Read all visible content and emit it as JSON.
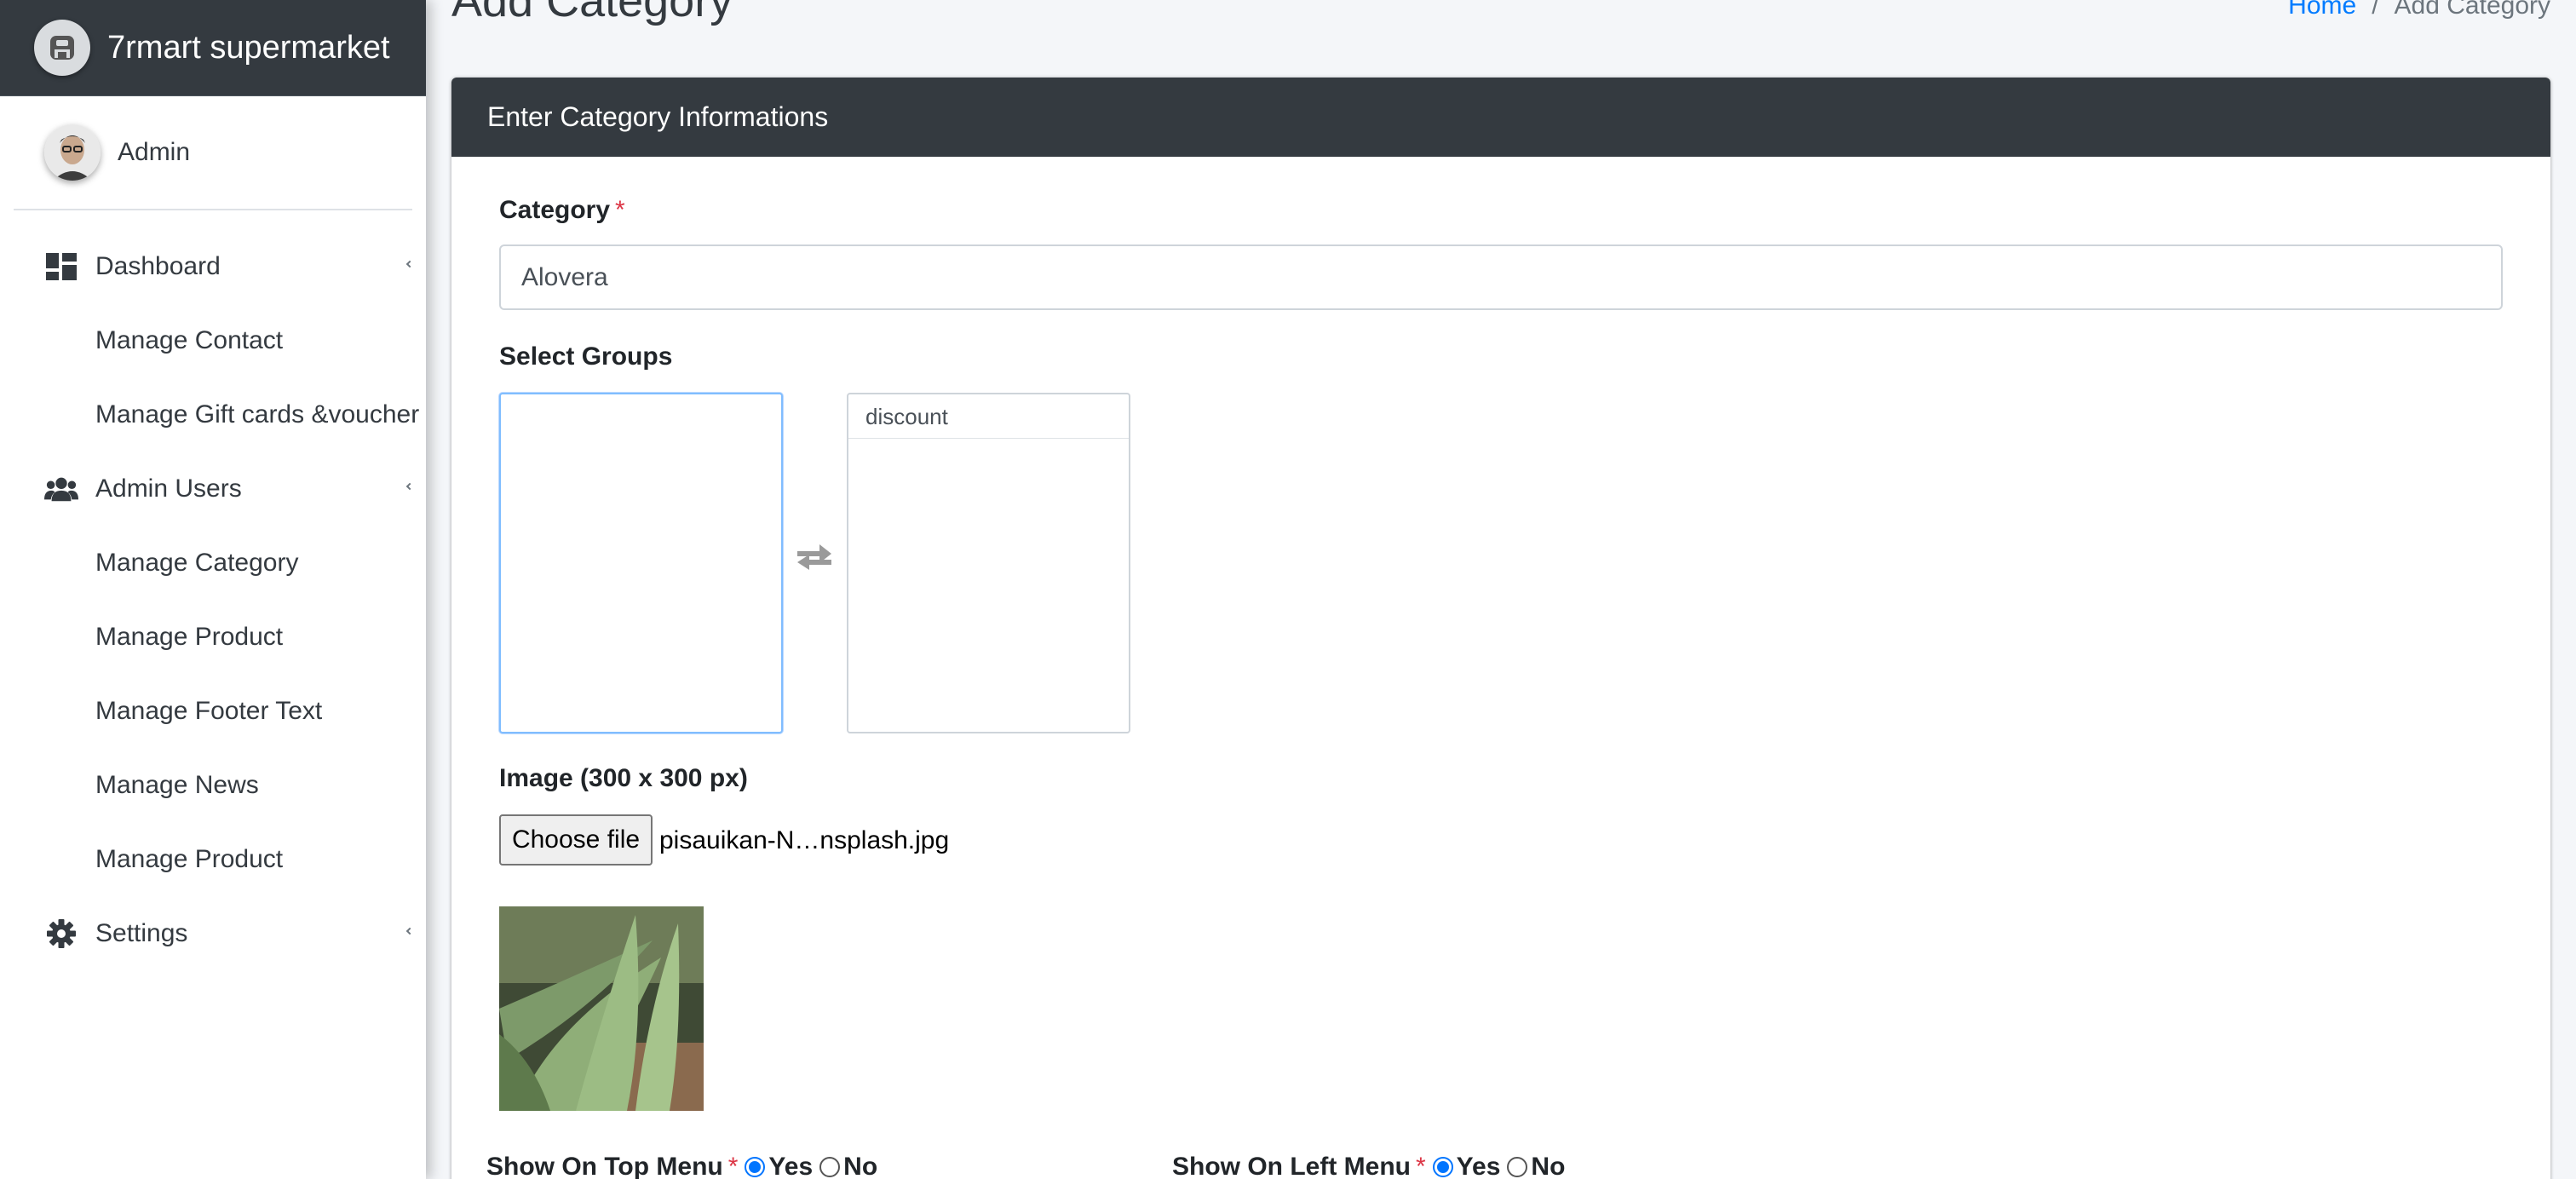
{
  "app": {
    "brand_name": "7rmart supermarket",
    "brand_icon": "shop-logo-icon",
    "user_name": "Admin"
  },
  "sidebar": {
    "items": [
      {
        "label": "Dashboard",
        "icon": "dashboard-icon",
        "has_caret": true
      },
      {
        "label": "Manage Contact"
      },
      {
        "label": "Manage Gift cards &voucher"
      },
      {
        "label": "Admin Users",
        "icon": "users-icon",
        "has_caret": true
      },
      {
        "label": "Manage Category"
      },
      {
        "label": "Manage Product"
      },
      {
        "label": "Manage Footer Text"
      },
      {
        "label": "Manage News"
      },
      {
        "label": "Manage Product"
      },
      {
        "label": "Settings",
        "icon": "gear-icon",
        "has_caret": true
      }
    ]
  },
  "header": {
    "title": "Add Category",
    "breadcrumb": {
      "home": "Home",
      "separator": "/",
      "current": "Add Category"
    }
  },
  "card": {
    "title": "Enter Category Informations"
  },
  "form": {
    "category": {
      "label": "Category",
      "required_mark": "*",
      "value": "Alovera"
    },
    "groups": {
      "label": "Select Groups",
      "selected": [],
      "available": [
        "discount"
      ]
    },
    "image": {
      "label": "Image (300 x 300 px)",
      "button_label": "Choose file",
      "file_name": "pisauikan-N…nsplash.jpg"
    },
    "top_menu": {
      "label": "Show On Top Menu",
      "required_mark": "*",
      "yes": "Yes",
      "no": "No",
      "selected": "Yes"
    },
    "left_menu": {
      "label": "Show On Left Menu",
      "required_mark": "*",
      "yes": "Yes",
      "no": "No",
      "selected": "Yes"
    }
  },
  "colors": {
    "sidebar_dark": "#343a40",
    "link_blue": "#007bff",
    "required_red": "#dc3545",
    "radio_blue": "#0075ff"
  }
}
